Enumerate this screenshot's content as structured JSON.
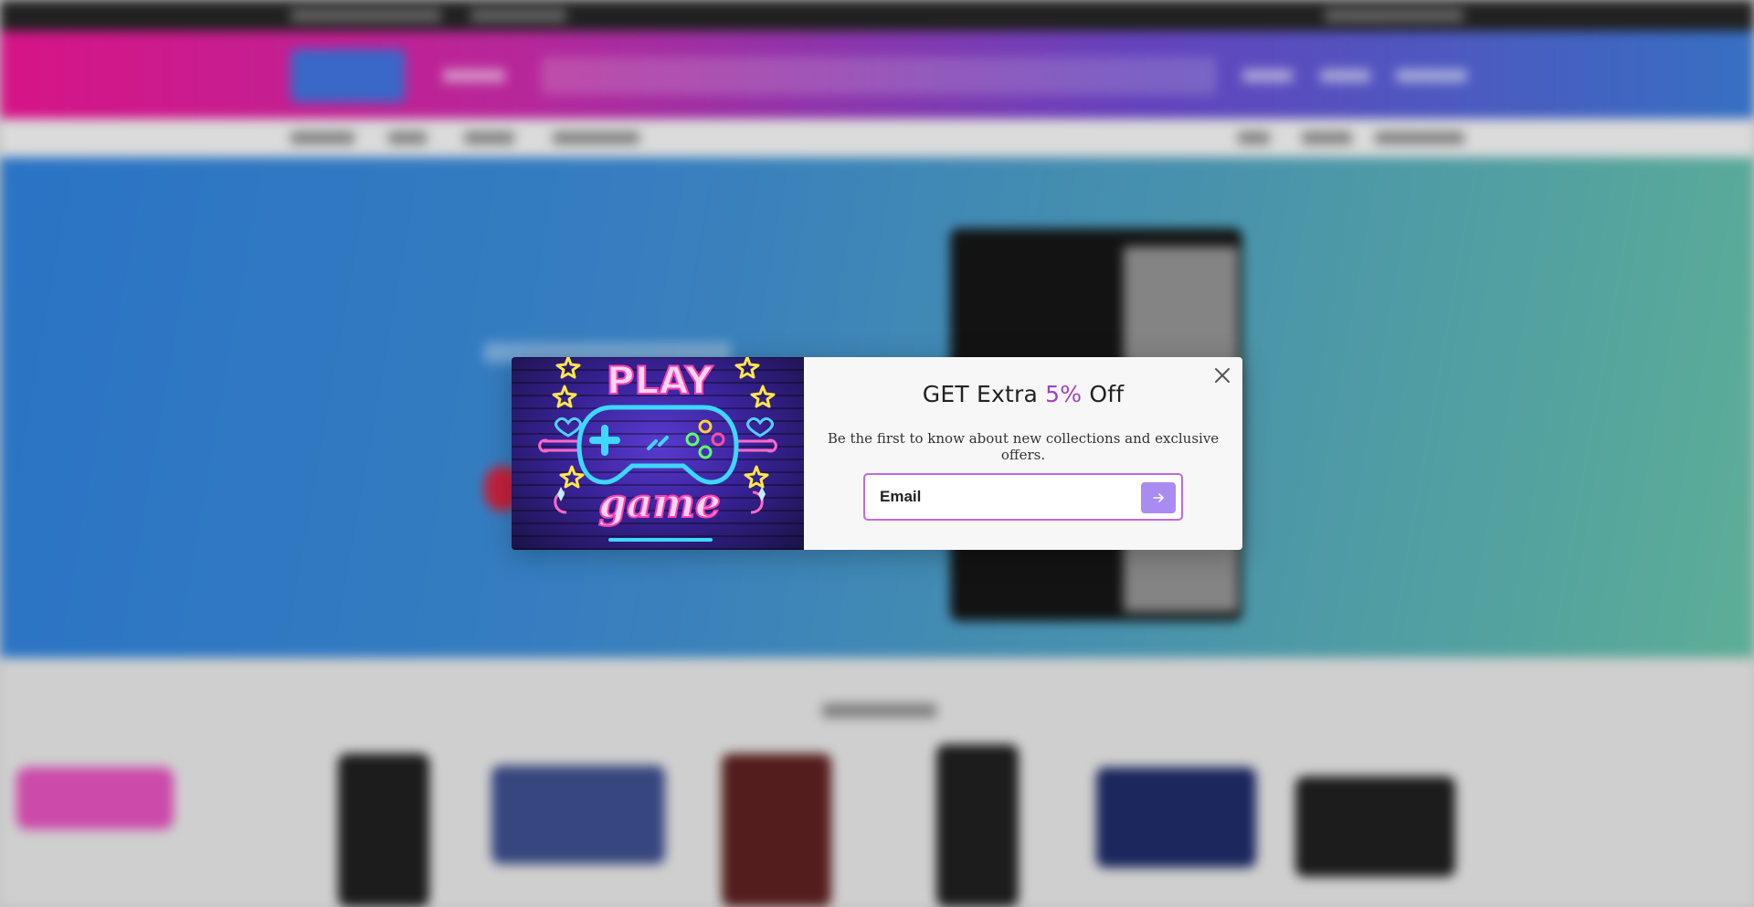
{
  "popup": {
    "title_prefix": "GET Extra ",
    "title_highlight": "5%",
    "title_suffix": " Off",
    "subtitle": "Be the first to know about new collections and exclusive offers.",
    "email_placeholder": "Email",
    "close_icon": "close-icon",
    "submit_icon": "arrow-right-icon",
    "image_text_top": "PLAY",
    "image_text_bottom": "game"
  },
  "colors": {
    "accent": "#a341c2",
    "submit_button": "#a98bf2",
    "input_border": "#c667e0",
    "header_gradient_start": "#e4168f",
    "header_gradient_end": "#3a77d0"
  }
}
